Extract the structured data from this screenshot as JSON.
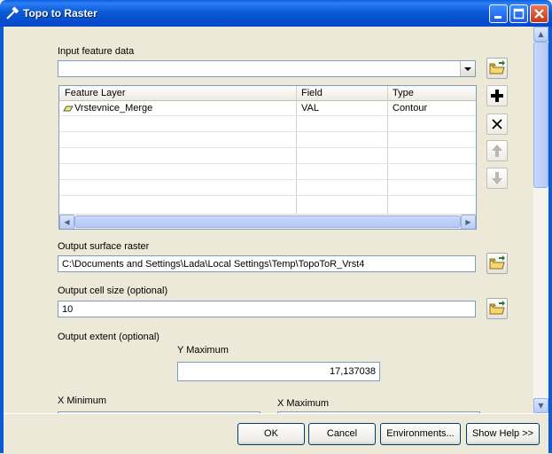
{
  "window": {
    "title": "Topo to Raster"
  },
  "input_feature": {
    "label": "Input feature data",
    "value": "",
    "table": {
      "columns": [
        "Feature Layer",
        "Field",
        "Type"
      ],
      "rows": [
        {
          "layer": "Vrstevnice_Merge",
          "field": "VAL",
          "type": "Contour"
        }
      ]
    }
  },
  "output_surface": {
    "label": "Output surface raster",
    "value": "C:\\Documents and Settings\\Lada\\Local Settings\\Temp\\TopoToR_Vrst4"
  },
  "cell_size": {
    "label": "Output cell size (optional)",
    "value": "10"
  },
  "extent": {
    "label": "Output extent (optional)",
    "ymax_label": "Y Maximum",
    "ymax_value": "17,137038",
    "xmin_label": "X Minimum",
    "xmax_label": "X Maximum"
  },
  "buttons": {
    "ok": "OK",
    "cancel": "Cancel",
    "environments": "Environments...",
    "show_help": "Show Help >>"
  }
}
